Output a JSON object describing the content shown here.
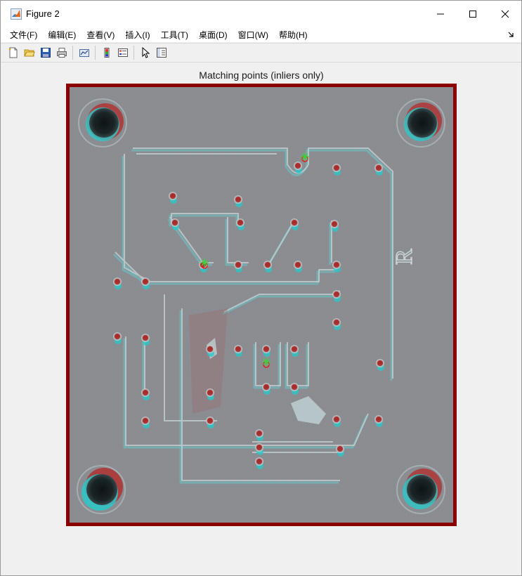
{
  "window": {
    "title": "Figure 2",
    "controls": {
      "minimize": "minimize",
      "maximize": "maximize",
      "close": "close"
    }
  },
  "menu": {
    "items": [
      "文件(F)",
      "编辑(E)",
      "查看(V)",
      "插入(I)",
      "工具(T)",
      "桌面(D)",
      "窗口(W)",
      "帮助(H)"
    ]
  },
  "toolbar": {
    "buttons": [
      "new-figure",
      "open-file",
      "save",
      "print",
      "link-plot",
      "insert-colorbar",
      "insert-legend",
      "edit-plot",
      "property-inspector"
    ]
  },
  "axes": {
    "title": "Matching points (inliers only)"
  },
  "board": {
    "letter": "R"
  },
  "colors": {
    "frame_red": "#8b0000",
    "board": "#8a8c91",
    "red_tint": "#b03030",
    "cyan_tint": "#2cc8c8",
    "inlier_green": "#3cd13c",
    "inlier_red": "#e02020"
  }
}
